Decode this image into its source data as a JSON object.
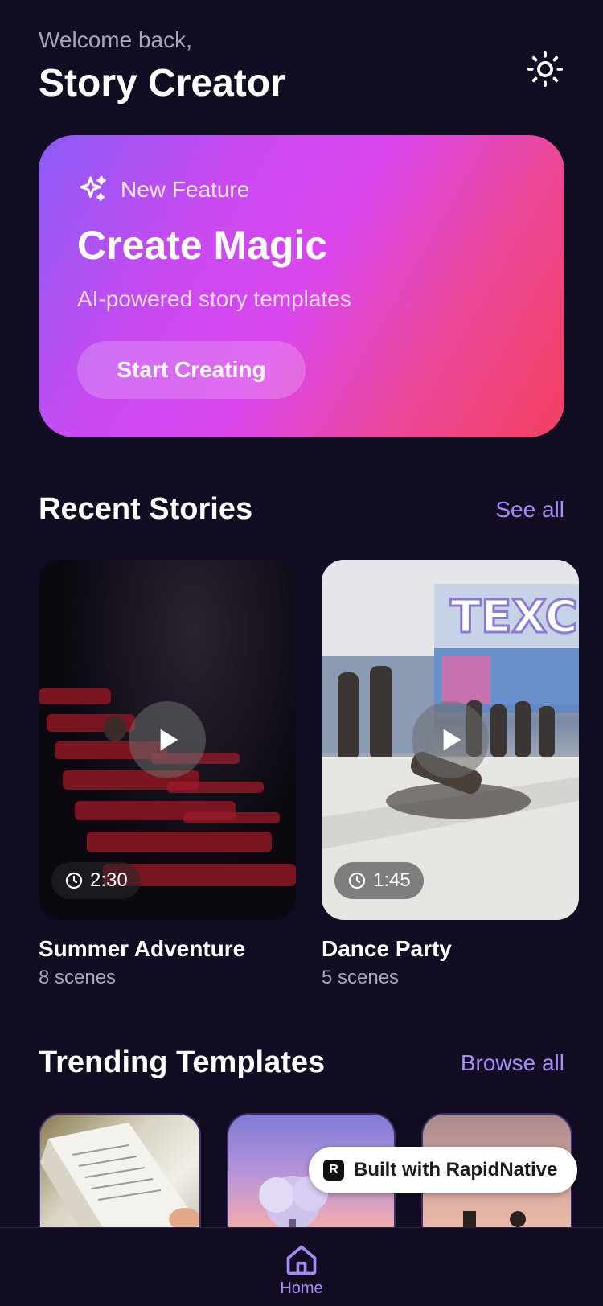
{
  "header": {
    "welcome": "Welcome back,",
    "title": "Story Creator"
  },
  "hero": {
    "badge": "New Feature",
    "title": "Create Magic",
    "subtitle": "AI-powered story templates",
    "cta": "Start Creating"
  },
  "recent": {
    "title": "Recent Stories",
    "link": "See all",
    "stories": [
      {
        "name": "Summer Adventure",
        "scenes": "8 scenes",
        "duration": "2:30"
      },
      {
        "name": "Dance Party",
        "scenes": "5 scenes",
        "duration": "1:45"
      }
    ]
  },
  "trending": {
    "title": "Trending Templates",
    "link": "Browse all"
  },
  "built_badge": "Built with RapidNative",
  "tabbar": {
    "home": "Home"
  },
  "colors": {
    "background": "#110c22",
    "accent": "#a78bfa",
    "hero_gradient": [
      "#8b5cf6",
      "#d946ef",
      "#f43f5e"
    ]
  },
  "icons": {
    "theme": "sun-icon",
    "badge": "sparkles-icon",
    "play": "play-icon",
    "duration": "clock-icon",
    "home": "home-icon"
  }
}
